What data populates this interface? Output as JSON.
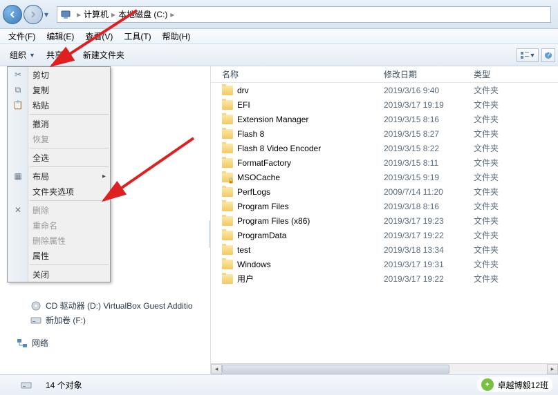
{
  "breadcrumb": {
    "root_icon": "computer",
    "parts": [
      "计算机",
      "本地磁盘 (C:)"
    ]
  },
  "menubar": [
    "文件(F)",
    "编辑(E)",
    "查看(V)",
    "工具(T)",
    "帮助(H)"
  ],
  "toolbar": {
    "organize": "组织",
    "share": "共享",
    "new_folder": "新建文件夹"
  },
  "organize_menu": {
    "cut": "剪切",
    "copy": "复制",
    "paste": "粘贴",
    "undo": "撤消",
    "redo": "恢复",
    "select_all": "全选",
    "layout": "布局",
    "folder_options": "文件夹选项",
    "delete": "删除",
    "rename": "重命名",
    "remove_props": "删除属性",
    "properties": "属性",
    "close": "关闭"
  },
  "columns": {
    "name": "名称",
    "date": "修改日期",
    "type": "类型"
  },
  "files": [
    {
      "name": "drv",
      "date": "2019/3/16 9:40",
      "type": "文件夹",
      "lock": false
    },
    {
      "name": "EFI",
      "date": "2019/3/17 19:19",
      "type": "文件夹",
      "lock": false
    },
    {
      "name": "Extension Manager",
      "date": "2019/3/15 8:16",
      "type": "文件夹",
      "lock": false
    },
    {
      "name": "Flash 8",
      "date": "2019/3/15 8:27",
      "type": "文件夹",
      "lock": false
    },
    {
      "name": "Flash 8 Video Encoder",
      "date": "2019/3/15 8:22",
      "type": "文件夹",
      "lock": false
    },
    {
      "name": "FormatFactory",
      "date": "2019/3/15 8:11",
      "type": "文件夹",
      "lock": false
    },
    {
      "name": "MSOCache",
      "date": "2019/3/15 9:19",
      "type": "文件夹",
      "lock": true
    },
    {
      "name": "PerfLogs",
      "date": "2009/7/14 11:20",
      "type": "文件夹",
      "lock": false
    },
    {
      "name": "Program Files",
      "date": "2019/3/18 8:16",
      "type": "文件夹",
      "lock": false
    },
    {
      "name": "Program Files (x86)",
      "date": "2019/3/17 19:23",
      "type": "文件夹",
      "lock": false
    },
    {
      "name": "ProgramData",
      "date": "2019/3/17 19:22",
      "type": "文件夹",
      "lock": false
    },
    {
      "name": "test",
      "date": "2019/3/18 13:34",
      "type": "文件夹",
      "lock": false
    },
    {
      "name": "Windows",
      "date": "2019/3/17 19:31",
      "type": "文件夹",
      "lock": false
    },
    {
      "name": "用户",
      "date": "2019/3/17 19:22",
      "type": "文件夹",
      "lock": false
    }
  ],
  "tree": {
    "visible_top": [],
    "cd_drive": "CD 驱动器 (D:) VirtualBox Guest Additio",
    "new_vol": "新加卷 (F:)",
    "network": "网络"
  },
  "status": {
    "count": "14 个对象"
  },
  "watermark": "卓越博毅12班"
}
